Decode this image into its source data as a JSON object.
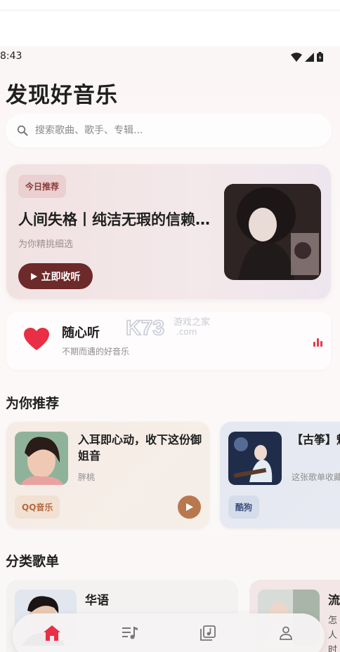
{
  "status": {
    "time": "8:43",
    "icons": [
      "wifi-icon",
      "signal-icon",
      "battery-icon"
    ]
  },
  "page": {
    "title": "发现好音乐"
  },
  "search": {
    "placeholder": "搜索歌曲、歌手、专辑..."
  },
  "hero": {
    "badge": "今日推荐",
    "title": "人间失格丨纯洁无瑕的信赖…",
    "subtitle": "为你精挑细选",
    "play_label": "立即收听"
  },
  "random": {
    "title": "随心听",
    "subtitle": "不期而遇的好音乐",
    "watermark_logo": "K73",
    "watermark_text": "游戏之家",
    "watermark_domain": ".com"
  },
  "sections": {
    "recommend": "为你推荐",
    "categories": "分类歌单"
  },
  "recommendations": [
    {
      "title": "入耳即心动，收下这份御姐音",
      "artist": "胖桃",
      "source": "QQ音乐"
    },
    {
      "title": "【古筝】魅惑之音",
      "artist": "这张歌单收藏",
      "source": "酷狗"
    }
  ],
  "categories": [
    {
      "label": "华语"
    },
    {
      "label": "流",
      "lines": [
        "怎",
        "人",
        "时"
      ]
    }
  ],
  "tabs": [
    "home-icon",
    "playlist-icon",
    "library-icon",
    "profile-icon"
  ],
  "colors": {
    "accent": "#e23a4a",
    "hero_button": "#6c2a2a",
    "play_button": "#b9774e"
  }
}
